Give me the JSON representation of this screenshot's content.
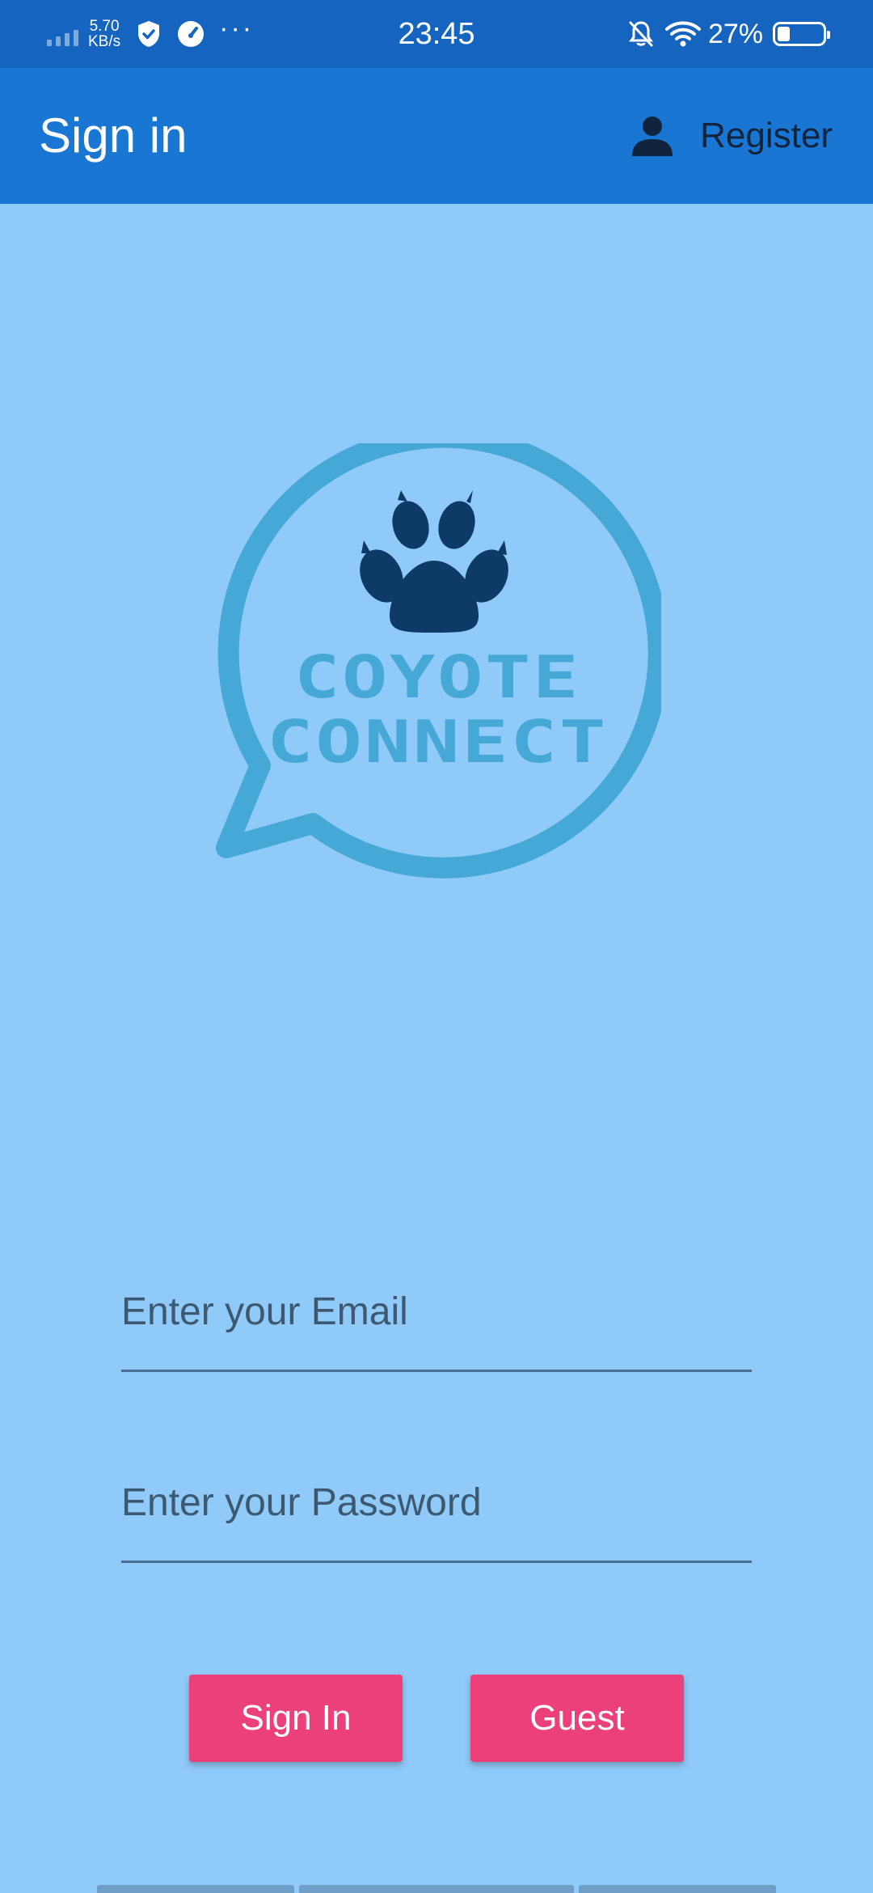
{
  "status_bar": {
    "net_speed_value": "5.70",
    "net_speed_unit": "KB/s",
    "time": "23:45",
    "battery_percent": "27%",
    "battery_level": 0.27,
    "icons": [
      "signal-icon",
      "shield-check-icon",
      "speedometer-icon",
      "more-dots-icon",
      "bell-off-icon",
      "wifi-icon",
      "battery-icon"
    ]
  },
  "app_bar": {
    "title": "Sign in",
    "register_label": "Register",
    "register_icon": "person-icon",
    "color": "#1976d2"
  },
  "logo": {
    "line1": "COYOTE",
    "line2": "CONNECT",
    "icon": "paw-print-icon"
  },
  "form": {
    "email_placeholder": "Enter your Email",
    "email_value": "",
    "password_placeholder": "Enter your Password",
    "password_value": ""
  },
  "buttons": {
    "sign_in_label": "Sign In",
    "guest_label": "Guest",
    "color": "#ec407a"
  },
  "colors": {
    "background": "#90caf9",
    "status_bar": "#1565c0",
    "logo": "#45a8d6",
    "paw": "#0d3a66"
  }
}
